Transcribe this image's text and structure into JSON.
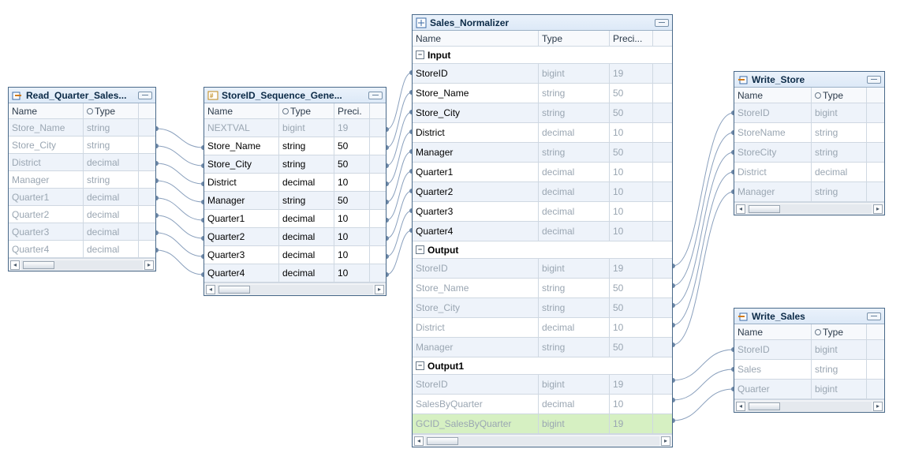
{
  "nodes": {
    "read_quarter": {
      "title": "Read_Quarter_Sales...",
      "headers": {
        "name": "Name",
        "type": "Type"
      },
      "rows": [
        {
          "name": "Store_Name",
          "type": "string",
          "dim": true
        },
        {
          "name": "Store_City",
          "type": "string",
          "dim": true
        },
        {
          "name": "District",
          "type": "decimal",
          "dim": true
        },
        {
          "name": "Manager",
          "type": "string",
          "dim": true
        },
        {
          "name": "Quarter1",
          "type": "decimal",
          "dim": true
        },
        {
          "name": "Quarter2",
          "type": "decimal",
          "dim": true
        },
        {
          "name": "Quarter3",
          "type": "decimal",
          "dim": true
        },
        {
          "name": "Quarter4",
          "type": "decimal",
          "dim": true
        }
      ]
    },
    "storeid_seq": {
      "title": "StoreID_Sequence_Gene...",
      "headers": {
        "name": "Name",
        "type": "Type",
        "precision": "Preci."
      },
      "rows": [
        {
          "name": "NEXTVAL",
          "type": "bigint",
          "precision": "19",
          "dim": true
        },
        {
          "name": "Store_Name",
          "type": "string",
          "precision": "50"
        },
        {
          "name": "Store_City",
          "type": "string",
          "precision": "50"
        },
        {
          "name": "District",
          "type": "decimal",
          "precision": "10"
        },
        {
          "name": "Manager",
          "type": "string",
          "precision": "50"
        },
        {
          "name": "Quarter1",
          "type": "decimal",
          "precision": "10"
        },
        {
          "name": "Quarter2",
          "type": "decimal",
          "precision": "10"
        },
        {
          "name": "Quarter3",
          "type": "decimal",
          "precision": "10"
        },
        {
          "name": "Quarter4",
          "type": "decimal",
          "precision": "10"
        }
      ]
    },
    "sales_norm": {
      "title": "Sales_Normalizer",
      "headers": {
        "name": "Name",
        "type": "Type",
        "precision": "Preci..."
      },
      "groups": {
        "input": {
          "label": "Input"
        },
        "output": {
          "label": "Output"
        },
        "output1": {
          "label": "Output1"
        }
      },
      "input_rows": [
        {
          "name": "StoreID",
          "type": "bigint",
          "precision": "19"
        },
        {
          "name": "Store_Name",
          "type": "string",
          "precision": "50"
        },
        {
          "name": "Store_City",
          "type": "string",
          "precision": "50"
        },
        {
          "name": "District",
          "type": "decimal",
          "precision": "10"
        },
        {
          "name": "Manager",
          "type": "string",
          "precision": "50"
        },
        {
          "name": "Quarter1",
          "type": "decimal",
          "precision": "10"
        },
        {
          "name": "Quarter2",
          "type": "decimal",
          "precision": "10"
        },
        {
          "name": "Quarter3",
          "type": "decimal",
          "precision": "10"
        },
        {
          "name": "Quarter4",
          "type": "decimal",
          "precision": "10"
        }
      ],
      "output_rows": [
        {
          "name": "StoreID",
          "type": "bigint",
          "precision": "19",
          "dim": true
        },
        {
          "name": "Store_Name",
          "type": "string",
          "precision": "50",
          "dim": true
        },
        {
          "name": "Store_City",
          "type": "string",
          "precision": "50",
          "dim": true
        },
        {
          "name": "District",
          "type": "decimal",
          "precision": "10",
          "dim": true
        },
        {
          "name": "Manager",
          "type": "string",
          "precision": "50",
          "dim": true
        }
      ],
      "output1_rows": [
        {
          "name": "StoreID",
          "type": "bigint",
          "precision": "19",
          "dim": true
        },
        {
          "name": "SalesByQuarter",
          "type": "decimal",
          "precision": "10",
          "dim": true
        },
        {
          "name": "GCID_SalesByQuarter",
          "type": "bigint",
          "precision": "19",
          "dim": true,
          "highlight": true
        }
      ]
    },
    "write_store": {
      "title": "Write_Store",
      "headers": {
        "name": "Name",
        "type": "Type"
      },
      "rows": [
        {
          "name": "StoreID",
          "type": "bigint"
        },
        {
          "name": "StoreName",
          "type": "string"
        },
        {
          "name": "StoreCity",
          "type": "string"
        },
        {
          "name": "District",
          "type": "decimal"
        },
        {
          "name": "Manager",
          "type": "string"
        }
      ]
    },
    "write_sales": {
      "title": "Write_Sales",
      "headers": {
        "name": "Name",
        "type": "Type"
      },
      "rows": [
        {
          "name": "StoreID",
          "type": "bigint"
        },
        {
          "name": "Sales",
          "type": "string"
        },
        {
          "name": "Quarter",
          "type": "bigint"
        }
      ]
    }
  }
}
